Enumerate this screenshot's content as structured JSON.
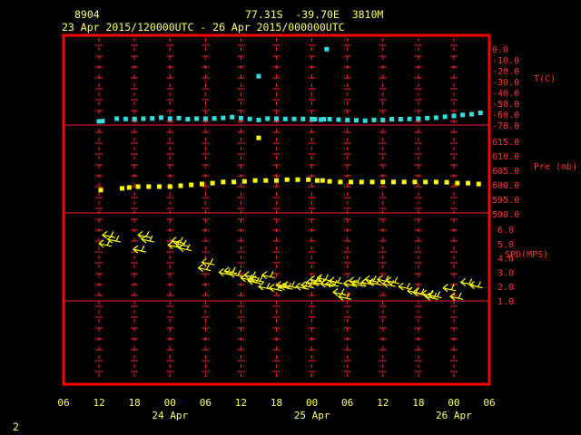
{
  "header": {
    "station_id": "8904",
    "location": "77.31S  -39.70E  3810M",
    "time_range": "23 Apr 2015/120000UTC - 26 Apr 2015/000000UTC"
  },
  "footer": {
    "page_number": "2"
  },
  "colors": {
    "frame": "#ff0000",
    "axis": "#ff2222",
    "temperature": "#33dddd",
    "pressure": "#ffff00",
    "wind": "#ffff00",
    "text": "#ffff66"
  },
  "chart_data": {
    "type": "scatter",
    "x_axis": {
      "unit": "hours from 23 Apr 2015 06 UTC",
      "range": [
        0,
        72
      ],
      "tick_labels": [
        "06",
        "12",
        "18",
        "00",
        "06",
        "12",
        "18",
        "00",
        "06",
        "12",
        "18",
        "00",
        "06"
      ],
      "date_labels": [
        {
          "label": "24 Apr",
          "hour": 18
        },
        {
          "label": "25 Apr",
          "hour": 42
        },
        {
          "label": "26 Apr",
          "hour": 66
        }
      ]
    },
    "panels": [
      {
        "name": "temperature",
        "ylabel": "T(C)",
        "ylim": [
          -70,
          0
        ],
        "tick_labels": [
          "0.0",
          "-10.0",
          "-20.0",
          "-30.0",
          "-40.0",
          "-50.0",
          "-60.0",
          "-70.0"
        ],
        "tick_values": [
          0,
          -10,
          -20,
          -30,
          -40,
          -50,
          -60,
          -70
        ],
        "points": [
          {
            "x": 6.0,
            "y": -66.6
          },
          {
            "x": 6.6,
            "y": -66.4
          },
          {
            "x": 9.0,
            "y": -64.1
          },
          {
            "x": 10.5,
            "y": -64.4
          },
          {
            "x": 12.0,
            "y": -64.4
          },
          {
            "x": 13.5,
            "y": -64.1
          },
          {
            "x": 15.0,
            "y": -63.9
          },
          {
            "x": 16.5,
            "y": -63.2
          },
          {
            "x": 18.0,
            "y": -64.1
          },
          {
            "x": 19.5,
            "y": -63.6
          },
          {
            "x": 21.0,
            "y": -64.6
          },
          {
            "x": 22.5,
            "y": -64.1
          },
          {
            "x": 24.0,
            "y": -64.1
          },
          {
            "x": 25.5,
            "y": -63.9
          },
          {
            "x": 27.0,
            "y": -63.4
          },
          {
            "x": 28.5,
            "y": -62.7
          },
          {
            "x": 30.0,
            "y": -63.6
          },
          {
            "x": 31.5,
            "y": -64.4
          },
          {
            "x": 33.0,
            "y": -65.3
          },
          {
            "x": 34.5,
            "y": -64.1
          },
          {
            "x": 36.0,
            "y": -64.1
          },
          {
            "x": 37.5,
            "y": -64.4
          },
          {
            "x": 39.0,
            "y": -64.4
          },
          {
            "x": 40.5,
            "y": -64.4
          },
          {
            "x": 42.0,
            "y": -64.4
          },
          {
            "x": 42.5,
            "y": -64.6
          },
          {
            "x": 43.5,
            "y": -65.0
          },
          {
            "x": 44.0,
            "y": -64.6
          },
          {
            "x": 45.0,
            "y": -64.6
          },
          {
            "x": 46.5,
            "y": -65.0
          },
          {
            "x": 48.0,
            "y": -65.3
          },
          {
            "x": 49.5,
            "y": -65.6
          },
          {
            "x": 51.0,
            "y": -66.0
          },
          {
            "x": 52.5,
            "y": -65.3
          },
          {
            "x": 54.0,
            "y": -65.3
          },
          {
            "x": 55.5,
            "y": -64.6
          },
          {
            "x": 57.0,
            "y": -64.6
          },
          {
            "x": 58.5,
            "y": -64.4
          },
          {
            "x": 60.0,
            "y": -64.1
          },
          {
            "x": 61.5,
            "y": -63.6
          },
          {
            "x": 63.0,
            "y": -63.2
          },
          {
            "x": 64.5,
            "y": -62.3
          },
          {
            "x": 66.0,
            "y": -61.6
          },
          {
            "x": 67.5,
            "y": -60.7
          },
          {
            "x": 69.0,
            "y": -60.0
          },
          {
            "x": 70.5,
            "y": -58.8
          },
          {
            "x": 33.0,
            "y": -25.1
          },
          {
            "x": 44.5,
            "y": -0.2
          }
        ]
      },
      {
        "name": "pressure",
        "ylabel": "Pre (mb)",
        "ylim": [
          590,
          620
        ],
        "tick_labels": [
          "615.0",
          "610.0",
          "605.0",
          "600.0",
          "595.0",
          "590.0"
        ],
        "tick_values": [
          615,
          610,
          605,
          600,
          595,
          590
        ],
        "points": [
          {
            "x": 6.3,
            "y": 598.2
          },
          {
            "x": 9.9,
            "y": 598.8
          },
          {
            "x": 11.1,
            "y": 599.1
          },
          {
            "x": 12.6,
            "y": 599.4
          },
          {
            "x": 14.4,
            "y": 599.4
          },
          {
            "x": 16.2,
            "y": 599.4
          },
          {
            "x": 18.0,
            "y": 599.4
          },
          {
            "x": 19.8,
            "y": 599.7
          },
          {
            "x": 21.6,
            "y": 600.0
          },
          {
            "x": 23.4,
            "y": 600.3
          },
          {
            "x": 25.2,
            "y": 600.6
          },
          {
            "x": 27.0,
            "y": 601.0
          },
          {
            "x": 28.8,
            "y": 601.0
          },
          {
            "x": 30.6,
            "y": 601.2
          },
          {
            "x": 32.4,
            "y": 601.5
          },
          {
            "x": 34.2,
            "y": 601.5
          },
          {
            "x": 36.0,
            "y": 601.5
          },
          {
            "x": 37.8,
            "y": 601.8
          },
          {
            "x": 39.6,
            "y": 601.8
          },
          {
            "x": 41.4,
            "y": 601.8
          },
          {
            "x": 42.9,
            "y": 601.5
          },
          {
            "x": 43.8,
            "y": 601.5
          },
          {
            "x": 45.0,
            "y": 601.2
          },
          {
            "x": 46.8,
            "y": 601.0
          },
          {
            "x": 48.6,
            "y": 601.0
          },
          {
            "x": 50.4,
            "y": 601.0
          },
          {
            "x": 52.2,
            "y": 601.0
          },
          {
            "x": 54.0,
            "y": 601.0
          },
          {
            "x": 55.8,
            "y": 601.0
          },
          {
            "x": 57.6,
            "y": 601.0
          },
          {
            "x": 59.4,
            "y": 601.0
          },
          {
            "x": 61.2,
            "y": 601.0
          },
          {
            "x": 63.0,
            "y": 601.0
          },
          {
            "x": 64.8,
            "y": 600.9
          },
          {
            "x": 66.6,
            "y": 600.6
          },
          {
            "x": 68.4,
            "y": 600.6
          },
          {
            "x": 70.2,
            "y": 600.3
          },
          {
            "x": 33.0,
            "y": 616.2
          }
        ]
      },
      {
        "name": "wind_speed",
        "ylabel": "SPD(MPS)",
        "ylim": [
          0,
          6.5
        ],
        "tick_labels": [
          "6.0",
          "5.0",
          "4.0",
          "3.0",
          "2.0",
          "1.0"
        ],
        "tick_values": [
          6,
          5,
          4,
          3,
          2,
          1
        ],
        "wind_barbs": [
          {
            "x": 6.0,
            "speed": 5.0
          },
          {
            "x": 6.6,
            "speed": 5.6
          },
          {
            "x": 7.5,
            "speed": 5.3
          },
          {
            "x": 11.8,
            "speed": 4.6
          },
          {
            "x": 12.6,
            "speed": 5.6
          },
          {
            "x": 13.2,
            "speed": 5.3
          },
          {
            "x": 17.7,
            "speed": 4.9
          },
          {
            "x": 18.3,
            "speed": 5.2
          },
          {
            "x": 18.9,
            "speed": 5.0
          },
          {
            "x": 19.5,
            "speed": 4.7
          },
          {
            "x": 22.8,
            "speed": 3.3
          },
          {
            "x": 23.4,
            "speed": 3.7
          },
          {
            "x": 26.3,
            "speed": 3.0
          },
          {
            "x": 27.2,
            "speed": 3.1
          },
          {
            "x": 28.1,
            "speed": 2.9
          },
          {
            "x": 30.0,
            "speed": 2.6
          },
          {
            "x": 30.6,
            "speed": 2.8
          },
          {
            "x": 31.2,
            "speed": 2.4
          },
          {
            "x": 31.8,
            "speed": 2.5
          },
          {
            "x": 33.0,
            "speed": 2.0
          },
          {
            "x": 33.6,
            "speed": 2.8
          },
          {
            "x": 34.8,
            "speed": 1.9
          },
          {
            "x": 36.0,
            "speed": 2.1
          },
          {
            "x": 36.6,
            "speed": 2.0
          },
          {
            "x": 37.2,
            "speed": 2.1
          },
          {
            "x": 39.3,
            "speed": 2.0
          },
          {
            "x": 40.2,
            "speed": 2.1
          },
          {
            "x": 41.1,
            "speed": 2.3
          },
          {
            "x": 41.7,
            "speed": 2.5
          },
          {
            "x": 42.3,
            "speed": 2.3
          },
          {
            "x": 42.9,
            "speed": 2.6
          },
          {
            "x": 43.5,
            "speed": 2.2
          },
          {
            "x": 44.4,
            "speed": 2.2
          },
          {
            "x": 45.0,
            "speed": 2.4
          },
          {
            "x": 45.6,
            "speed": 1.6
          },
          {
            "x": 46.5,
            "speed": 1.3
          },
          {
            "x": 47.4,
            "speed": 2.2
          },
          {
            "x": 48.3,
            "speed": 2.4
          },
          {
            "x": 48.9,
            "speed": 2.2
          },
          {
            "x": 50.4,
            "speed": 2.3
          },
          {
            "x": 51.0,
            "speed": 2.5
          },
          {
            "x": 51.6,
            "speed": 2.3
          },
          {
            "x": 53.1,
            "speed": 2.5
          },
          {
            "x": 54.0,
            "speed": 2.2
          },
          {
            "x": 54.6,
            "speed": 2.4
          },
          {
            "x": 56.7,
            "speed": 2.0
          },
          {
            "x": 58.2,
            "speed": 1.7
          },
          {
            "x": 59.1,
            "speed": 1.6
          },
          {
            "x": 60.6,
            "speed": 1.5
          },
          {
            "x": 61.2,
            "speed": 1.3
          },
          {
            "x": 61.8,
            "speed": 1.4
          },
          {
            "x": 64.2,
            "speed": 1.9
          },
          {
            "x": 65.4,
            "speed": 1.3
          },
          {
            "x": 67.2,
            "speed": 2.3
          },
          {
            "x": 68.7,
            "speed": 2.1
          }
        ]
      }
    ]
  }
}
